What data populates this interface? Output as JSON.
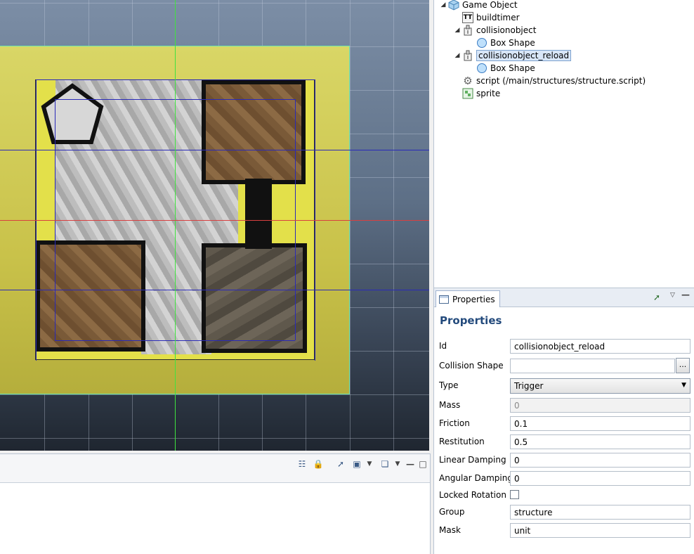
{
  "outline": {
    "items": [
      {
        "label": "Game Object",
        "icon": "cube-icon",
        "expanded": true
      },
      {
        "label": "buildtimer",
        "icon": "text-icon"
      },
      {
        "label": "collisionobject",
        "icon": "collision-object-icon",
        "expanded": true
      },
      {
        "label": "Box Shape",
        "icon": "circle-shape-icon"
      },
      {
        "label": "collisionobject_reload",
        "icon": "collision-object-icon",
        "expanded": true,
        "selected": true
      },
      {
        "label": "Box Shape",
        "icon": "circle-shape-icon"
      },
      {
        "label": "script (/main/structures/structure.script)",
        "icon": "gear-icon"
      },
      {
        "label": "sprite",
        "icon": "sprite-icon"
      }
    ]
  },
  "properties": {
    "tab_label": "Properties",
    "title": "Properties",
    "fields": {
      "id": {
        "label": "Id",
        "value": "collisionobject_reload"
      },
      "collision_shape": {
        "label": "Collision Shape",
        "value": "",
        "button": "..."
      },
      "type": {
        "label": "Type",
        "value": "Trigger"
      },
      "mass": {
        "label": "Mass",
        "value": "0"
      },
      "friction": {
        "label": "Friction",
        "value": "0.1"
      },
      "restitution": {
        "label": "Restitution",
        "value": "0.5"
      },
      "linear_damping": {
        "label": "Linear Damping",
        "value": "0"
      },
      "angular_damping": {
        "label": "Angular Damping",
        "value": "0"
      },
      "locked_rotation": {
        "label": "Locked Rotation",
        "checked": false
      },
      "group": {
        "label": "Group",
        "value": "structure"
      },
      "mask": {
        "label": "Mask",
        "value": "unit"
      }
    }
  },
  "colors": {
    "accent": "#234a7c",
    "selection": "#d8e6f8",
    "axis_x": "#d84040",
    "axis_y": "#3fe23f"
  }
}
